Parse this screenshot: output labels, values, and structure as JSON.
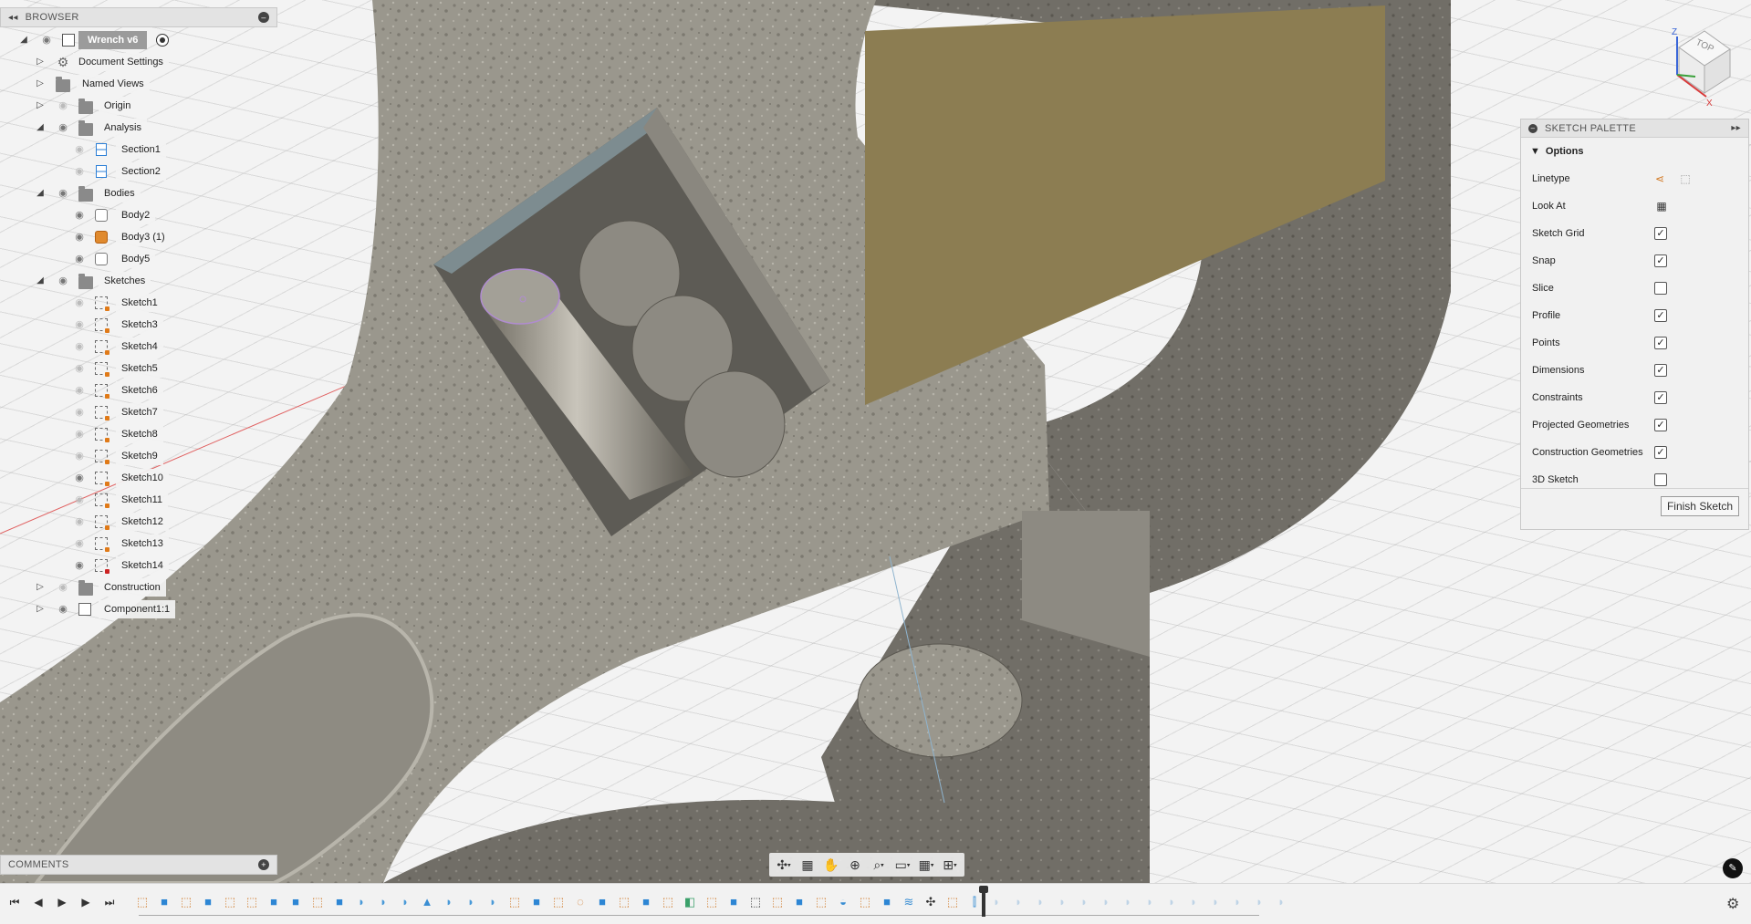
{
  "browser": {
    "title": "BROWSER",
    "root": {
      "label": "Wrench v6"
    },
    "items": [
      {
        "label": "Document Settings",
        "icon": "gear-icon"
      },
      {
        "label": "Named Views",
        "icon": "folder-icon"
      },
      {
        "label": "Origin",
        "icon": "folder-icon"
      },
      {
        "label": "Analysis",
        "icon": "folder-icon"
      },
      {
        "label": "Section1",
        "icon": "section-analysis-icon"
      },
      {
        "label": "Section2",
        "icon": "section-analysis-icon"
      },
      {
        "label": "Bodies",
        "icon": "folder-icon"
      },
      {
        "label": "Body2",
        "icon": "body-icon"
      },
      {
        "label": "Body3 (1)",
        "icon": "body-icon"
      },
      {
        "label": "Body5",
        "icon": "body-icon"
      },
      {
        "label": "Sketches",
        "icon": "folder-icon"
      },
      {
        "label": "Sketch1",
        "icon": "sketch-icon"
      },
      {
        "label": "Sketch3",
        "icon": "sketch-icon"
      },
      {
        "label": "Sketch4",
        "icon": "sketch-icon"
      },
      {
        "label": "Sketch5",
        "icon": "sketch-icon"
      },
      {
        "label": "Sketch6",
        "icon": "sketch-icon"
      },
      {
        "label": "Sketch7",
        "icon": "sketch-icon"
      },
      {
        "label": "Sketch8",
        "icon": "sketch-icon"
      },
      {
        "label": "Sketch9",
        "icon": "sketch-icon"
      },
      {
        "label": "Sketch10",
        "icon": "sketch-icon"
      },
      {
        "label": "Sketch11",
        "icon": "sketch-icon"
      },
      {
        "label": "Sketch12",
        "icon": "sketch-icon"
      },
      {
        "label": "Sketch13",
        "icon": "sketch-icon"
      },
      {
        "label": "Sketch14",
        "icon": "sketch-icon"
      },
      {
        "label": "Construction",
        "icon": "folder-icon"
      },
      {
        "label": "Component1:1",
        "icon": "component-icon"
      }
    ]
  },
  "comments": {
    "title": "COMMENTS"
  },
  "viewcube": {
    "face_top": "TOP",
    "axis_z": "Z",
    "axis_x": "X"
  },
  "palette": {
    "title": "SKETCH PALETTE",
    "section": "Options",
    "options": [
      {
        "label": "Linetype",
        "control": "linetype-buttons"
      },
      {
        "label": "Look At",
        "control": "look-at-button"
      },
      {
        "label": "Sketch Grid",
        "checked": true
      },
      {
        "label": "Snap",
        "checked": true
      },
      {
        "label": "Slice",
        "checked": false
      },
      {
        "label": "Profile",
        "checked": true
      },
      {
        "label": "Points",
        "checked": true
      },
      {
        "label": "Dimensions",
        "checked": true
      },
      {
        "label": "Constraints",
        "checked": true
      },
      {
        "label": "Projected Geometries",
        "checked": true
      },
      {
        "label": "Construction Geometries",
        "checked": true
      },
      {
        "label": "3D Sketch",
        "checked": false
      }
    ],
    "finish_label": "Finish Sketch"
  },
  "colors": {
    "accent_blue": "#2c7fd6",
    "sketch_orange": "#d07a2a",
    "model_gray": "#8c8a82",
    "panel_gold": "#8c7d52"
  }
}
